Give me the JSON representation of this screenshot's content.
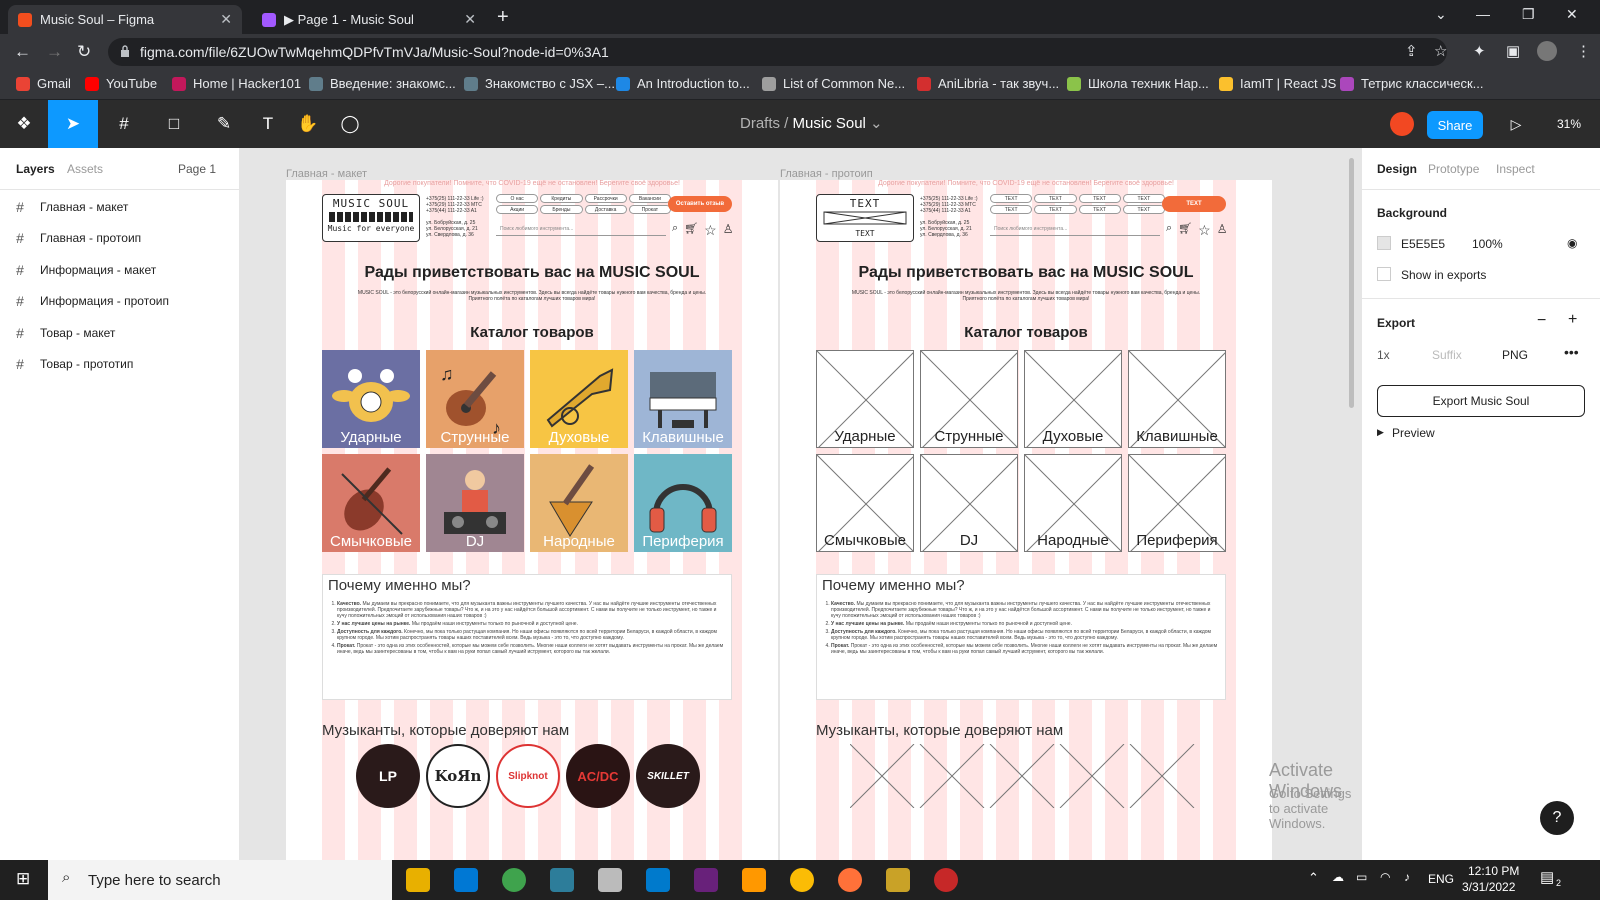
{
  "browser": {
    "tabs": [
      {
        "title": "Music Soul – Figma",
        "active": true
      },
      {
        "title": "▶ Page 1 - Music Soul",
        "active": false
      }
    ],
    "url": "figma.com/file/6ZUOwTwMqehmQDPfvTmVJa/Music-Soul?node-id=0%3A1",
    "bookmarks": [
      "Gmail",
      "YouTube",
      "Home | Hacker101",
      "Введение: знакомс...",
      "Знакомство с JSX –...",
      "An Introduction to...",
      "List of Common Ne...",
      "AniLibria - так звуч...",
      "Школа техник Нар...",
      "IamIT | React JS",
      "Тетрис классическ..."
    ]
  },
  "figma": {
    "breadcrumb_parent": "Drafts",
    "breadcrumb_file": "Music Soul",
    "share_label": "Share",
    "zoom": "31%",
    "left_tabs": {
      "layers": "Layers",
      "assets": "Assets",
      "page": "Page 1"
    },
    "layers": [
      "Главная - макет",
      "Главная - протоип",
      "Информация - макет",
      "Информация - протоип",
      "Товар - макет",
      "Товар - прототип"
    ],
    "right_tabs": {
      "design": "Design",
      "prototype": "Prototype",
      "inspect": "Inspect"
    },
    "background": {
      "title": "Background",
      "hex": "E5E5E5",
      "opacity": "100%",
      "show_in_exports": "Show in exports"
    },
    "export": {
      "title": "Export",
      "scale": "1x",
      "suffix_placeholder": "Suffix",
      "format": "PNG",
      "button": "Export Music Soul",
      "preview": "Preview"
    }
  },
  "frames": {
    "left": {
      "label": "Главная - макет",
      "covid": "Дорогие покупатели! Помните, что COVID-19 ещё не остановлен! Берегите своё здоровье!",
      "logo_title": "MUSIC SOUL",
      "logo_sub": "Music for everyone",
      "phones": [
        "+375(25) 111-22-33 Life :)",
        "+375(29) 111-22-33 МТС",
        "+375(44) 111-22-33 A1"
      ],
      "addresses": [
        "ул. Бобруйская, д. 25",
        "ул. Белорусская, д. 21",
        "ул. Свердлова, д. 36"
      ],
      "nav": [
        "О нас",
        "Кредиты",
        "Рассрочки",
        "Вакансии",
        "Акции",
        "Бренды",
        "Доставка",
        "Прокат"
      ],
      "cta": "Оставить отзыв",
      "search_placeholder": "Поиск любимого инструмента...",
      "welcome": "Рады приветствовать вас на MUSIC SOUL",
      "intro": "MUSIC SOUL - это белорусский онлайн-магазин музыкальных инструментов. Здесь вы всегда найдёте товары нужного вам качества, бренда и цены. Приятного полёта по каталогам лучших товаров мира!",
      "catalog_title": "Каталог товаров",
      "categories": [
        "Ударные",
        "Струнные",
        "Духовые",
        "Клавишные",
        "Смычковые",
        "DJ",
        "Народные",
        "Периферия"
      ],
      "why_title": "Почему именно мы?",
      "why_items": [
        {
          "bold": "Качество.",
          "text": "Мы думаем вы прекрасно понимаете, что для музыканта важны инструменты лучшего качества. У нас вы найдёте лучшие инструменты отечественных производителей. Предпочитаете зарубежные товары? Что ж, и на это у нас найдётся большой ассортимент. С нами вы получите не только инструмент, но также и кучу положительных эмоций от использования наших товаров :)"
        },
        {
          "bold": "У нас лучшие цены  на рынке.",
          "text": "Мы продаём наши инструменты только по рыночной и доступной цене."
        },
        {
          "bold": "Доступность для каждого.",
          "text": "Конечно, мы пока только растущая компания. Но наши офисы появляются по всей территории Беларуси, в каждой области, в каждом крупном городе. Мы хотим распространять товары наших поставителей всем. Ведь музыка - это то, что доступно каждому."
        },
        {
          "bold": "Прокат.",
          "text": "Прокат - это одна из этих особенностей, которые мы можем себе позволить. Многие наши коллеги не хотят выдавать инструменты на прокат. Мы же делаем иначе, ведь мы заинтересованы в том, чтобы к вам на руки попал самый лучший иструмент, которого вы так желали."
        }
      ],
      "trust_title": "Музыканты, которые доверяют нам",
      "bands": [
        "LP",
        "KoЯn",
        "Slipknot",
        "AC/DC",
        "SKILLET"
      ]
    },
    "right": {
      "label": "Главная - протоип",
      "covid": "Дорогие покупатели! Помните, что COVID-19 ещё не остановлен! Берегите своё здоровье!",
      "logo_text": "TEXT",
      "phones": [
        "+375(25) 111-22-33 Life :)",
        "+375(29) 111-22-33 МТС",
        "+375(44) 111-22-33 A1"
      ],
      "addresses": [
        "ул. Бобруйская, д. 25",
        "ул. Белорусская, д. 21",
        "ул. Свердлова, д. 36"
      ],
      "nav": [
        "TEXT",
        "TEXT",
        "TEXT",
        "TEXT",
        "TEXT",
        "TEXT",
        "TEXT",
        "TEXT"
      ],
      "cta": "TEXT",
      "search_placeholder": "Поиск любимого инструмента...",
      "welcome": "Рады приветствовать вас на MUSIC SOUL",
      "intro": "MUSIC SOUL - это белорусский онлайн-магазин музыкальных инструментов. Здесь вы всегда найдёте товары нужного вам качества, бренда и цены. Приятного полёта по каталогам лучших товаров мира!",
      "catalog_title": "Каталог товаров",
      "categories": [
        "Ударные",
        "Струнные",
        "Духовые",
        "Клавишные",
        "Смычковые",
        "DJ",
        "Народные",
        "Периферия"
      ],
      "why_title": "Почему именно мы?",
      "trust_title": "Музыканты, которые доверяют нам"
    }
  },
  "watermark": {
    "line1": "Activate Windows",
    "line2": "Go to Settings to activate Windows."
  },
  "taskbar": {
    "search_placeholder": "Type here to search",
    "lang": "ENG",
    "time": "12:10 PM",
    "date": "3/31/2022",
    "notifications": "2"
  },
  "colors": {
    "accent": "#0d99ff",
    "cta": "#f26b3a",
    "layout_grid": "#ffd6d6"
  }
}
